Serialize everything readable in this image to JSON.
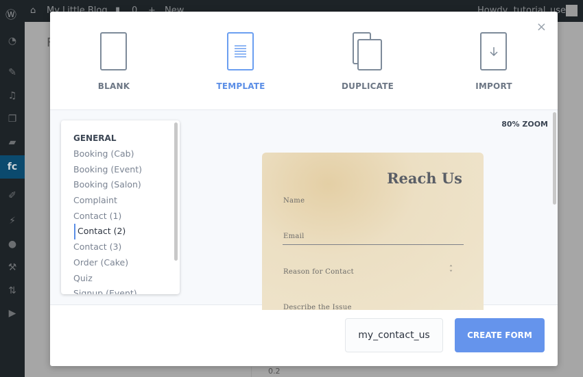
{
  "adminbar": {
    "site_name": "My Little Blog",
    "comments_count": "0",
    "new_label": "New",
    "greeting": "Howdy, tutorial_user"
  },
  "sidebar": {
    "items": [
      "dashboard-icon",
      "pin-icon",
      "media-icon",
      "pages-icon",
      "comments-icon",
      "fluentforms-icon",
      "appearance-icon",
      "plugins-icon",
      "users-icon",
      "tools-icon",
      "settings-icon",
      "video-icon"
    ],
    "active_label": "fc"
  },
  "background": {
    "page_title_fragment": "F",
    "table_value": "0.2"
  },
  "modal": {
    "close_icon": "×",
    "options": [
      {
        "label": "BLANK",
        "icon": "blank-page-icon"
      },
      {
        "label": "TEMPLATE",
        "icon": "template-page-icon",
        "selected": true
      },
      {
        "label": "DUPLICATE",
        "icon": "duplicate-icon"
      },
      {
        "label": "IMPORT",
        "icon": "import-icon"
      }
    ],
    "zoom_label": "80% ZOOM",
    "template_list": {
      "heading": "GENERAL",
      "items": [
        "Booking (Cab)",
        "Booking (Event)",
        "Booking (Salon)",
        "Complaint",
        "Contact (1)",
        "Contact (2)",
        "Contact (3)",
        "Order (Cake)",
        "Quiz",
        "Signup (Event)"
      ],
      "selected": "Contact (2)"
    },
    "preview": {
      "title": "Reach Us",
      "fields": [
        "Name",
        "Email",
        "Reason for Contact",
        "Describe the Issue"
      ]
    },
    "form_name": "my_contact_us",
    "create_label": "CREATE FORM"
  },
  "colors": {
    "accent": "#6594ec",
    "adminbar": "#1d2327",
    "active_menu": "#0b4a6e"
  }
}
